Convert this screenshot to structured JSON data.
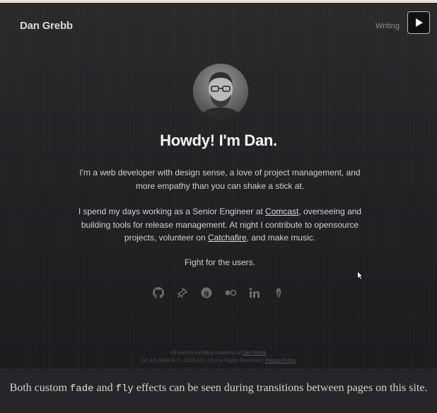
{
  "header": {
    "brand": "Dan Grebb",
    "nav_writing": "Writing"
  },
  "hero": {
    "headline": "Howdy! I'm Dan.",
    "intro": "I'm a web developer with design sense, a love of project management, and more empathy than you can shake a stick at.",
    "work_before_comcast": "I spend my days working as a Senior Engineer at ",
    "comcast": "Comcast",
    "work_middle": ", overseeing and building tools for release management. At night I contribute to opensource projects, volunteer on ",
    "catchafire": "Catchafire",
    "work_end": ", and make music.",
    "motto": "Fight for the users."
  },
  "socials": [
    "github-icon",
    "pin-icon",
    "goodreads-icon",
    "flickr-icon",
    "linkedin-icon",
    "leaf-icon"
  ],
  "footer": {
    "line1_prefix": "All text the fumbling creations of ",
    "line1_link": "Dan Grebb",
    "line2_text": "CC 4.5 billion B.C.–2023 A.D. | Some Rights Reserved | ",
    "line2_link": "Privacy Policy"
  },
  "caption": {
    "before_fade": "Both custom ",
    "fade": "fade",
    "and": " and ",
    "fly": "fly",
    "after": " effects can be seen during transitions between pages on this site."
  }
}
